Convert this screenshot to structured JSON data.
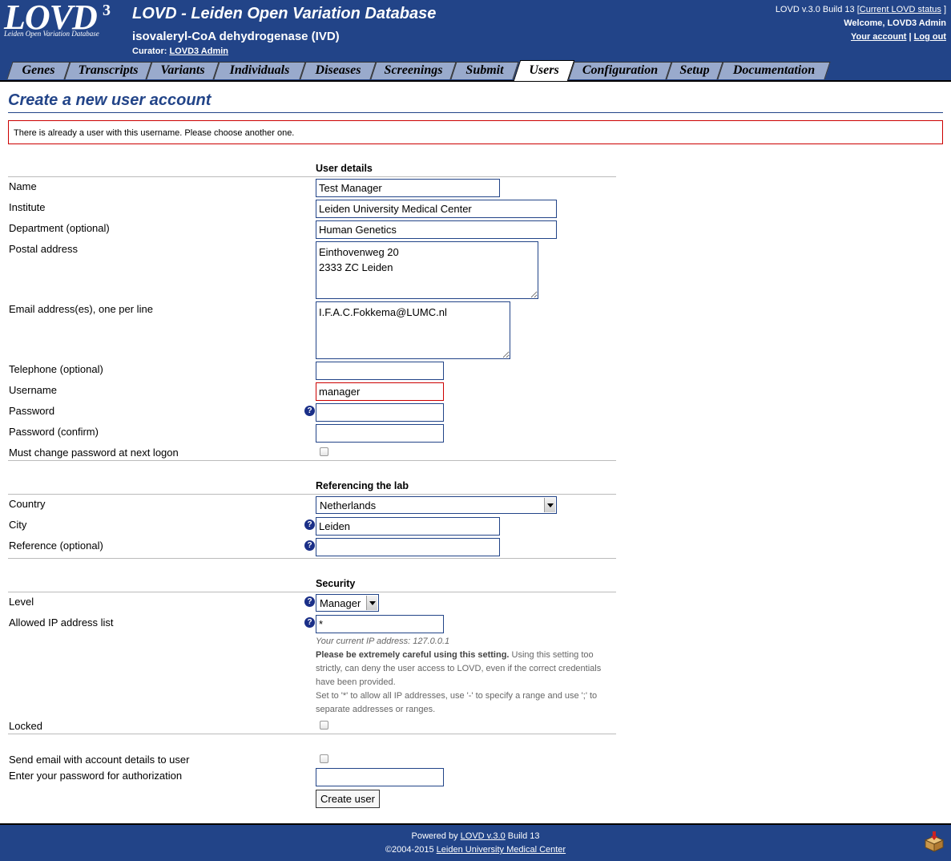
{
  "header": {
    "logo_text": "LOVD",
    "logo_superscript": "3",
    "logo_subtitle": "Leiden Open Variation Database",
    "site_title": "LOVD - Leiden Open Variation Database",
    "gene_title": "isovaleryl-CoA dehydrogenase (IVD)",
    "curator_label": "Curator:",
    "curator_name": "LOVD3 Admin",
    "version_prefix": "LOVD v.3.0 Build 13 [",
    "status_link": "Current LOVD status",
    "version_suffix": "]",
    "welcome": "Welcome, LOVD3 Admin",
    "your_account": "Your account",
    "separator": "|",
    "log_out": "Log out"
  },
  "tabs": [
    {
      "label": "Genes"
    },
    {
      "label": "Transcripts"
    },
    {
      "label": "Variants"
    },
    {
      "label": "Individuals"
    },
    {
      "label": "Diseases"
    },
    {
      "label": "Screenings"
    },
    {
      "label": "Submit"
    },
    {
      "label": "Users",
      "active": true
    },
    {
      "label": "Configuration"
    },
    {
      "label": "Setup"
    },
    {
      "label": "Documentation"
    }
  ],
  "page": {
    "title": "Create a new user account",
    "error": "There is already a user with this username. Please choose another one."
  },
  "form": {
    "user_details": {
      "heading": "User details",
      "name_label": "Name",
      "name_value": "Test Manager",
      "institute_label": "Institute",
      "institute_value": "Leiden University Medical Center",
      "department_label": "Department (optional)",
      "department_value": "Human Genetics",
      "postal_label": "Postal address",
      "postal_value": "Einthovenweg 20\n2333 ZC Leiden",
      "email_label": "Email address(es), one per line",
      "email_value": "I.F.A.C.Fokkema@LUMC.nl",
      "telephone_label": "Telephone (optional)",
      "telephone_value": "",
      "username_label": "Username",
      "username_value": "manager",
      "password_label": "Password",
      "password_confirm_label": "Password (confirm)",
      "must_change_label": "Must change password at next logon"
    },
    "lab": {
      "heading": "Referencing the lab",
      "country_label": "Country",
      "country_value": "Netherlands",
      "city_label": "City",
      "city_value": "Leiden",
      "reference_label": "Reference (optional)",
      "reference_value": ""
    },
    "security": {
      "heading": "Security",
      "level_label": "Level",
      "level_value": "Manager",
      "ip_label": "Allowed IP address list",
      "ip_value": "*",
      "ip_current": "Your current IP address: 127.0.0.1",
      "ip_warning_bold": "Please be extremely careful using this setting.",
      "ip_warning_rest": " Using this setting too strictly, can deny the user access to LOVD, even if the correct credentials have been provided.",
      "ip_help": "Set to '*' to allow all IP addresses, use '-' to specify a range and use ';' to separate addresses or ranges.",
      "locked_label": "Locked"
    },
    "send_email_label": "Send email with account details to user",
    "auth_password_label": "Enter your password for authorization",
    "submit_label": "Create user"
  },
  "footer": {
    "powered_prefix": "Powered by ",
    "powered_link": "LOVD v.3.0",
    "powered_suffix": " Build 13",
    "copyright_prefix": "©2004-2015 ",
    "copyright_link": "Leiden University Medical Center"
  },
  "icons": {
    "help": "help-icon",
    "package": "package-icon"
  }
}
